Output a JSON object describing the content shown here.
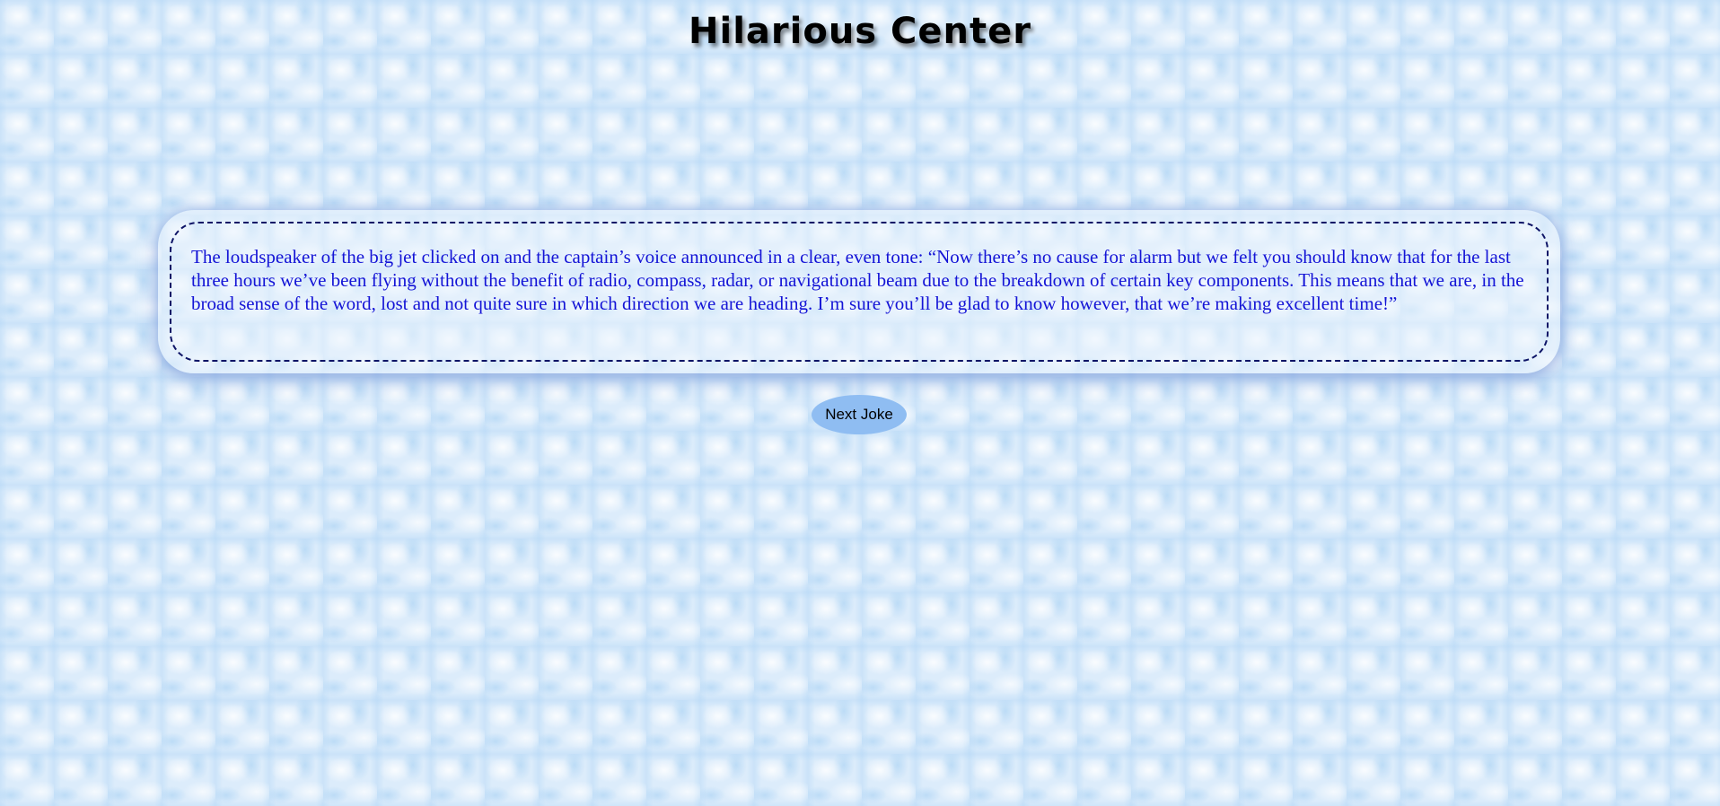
{
  "header": {
    "title": "Hilarious Center"
  },
  "joke": {
    "text": "The loudspeaker of the big jet clicked on and the captain’s voice announced in a clear, even tone: “Now there’s no cause for alarm but we felt you should know that for the last three hours we’ve been flying without the benefit of radio, compass, radar, or navigational beam due to the breakdown of certain key components. This means that we are, in the broad sense of the word, lost and not quite sure in which direction we are heading. I’m sure you’ll be glad to know however, that we’re making excellent time!”"
  },
  "controls": {
    "next_label": "Next Joke"
  },
  "colors": {
    "title": "#000000",
    "joke_text": "#1414d6",
    "card_border": "#0d1466",
    "button_bg": "#8fbdf2",
    "page_bg": "#dcecfb"
  }
}
